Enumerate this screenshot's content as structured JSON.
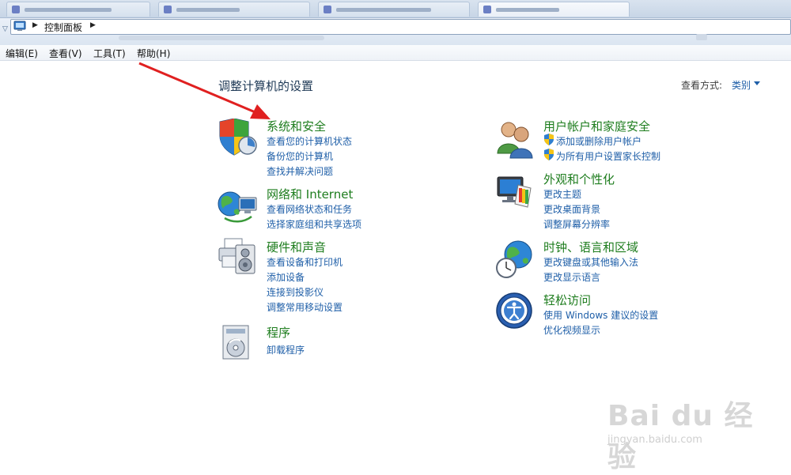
{
  "address": {
    "location": "控制面板"
  },
  "menu": [
    "编辑(E)",
    "查看(V)",
    "工具(T)",
    "帮助(H)"
  ],
  "page": {
    "title": "调整计算机的设置",
    "view_by_label": "查看方式:",
    "view_by_value": "类别"
  },
  "categories": [
    {
      "title": "系统和安全",
      "icon": "shield-system-icon",
      "links": [
        "查看您的计算机状态",
        "备份您的计算机",
        "查找并解决问题"
      ]
    },
    {
      "title": "网络和 Internet",
      "icon": "network-globe-icon",
      "links": [
        "查看网络状态和任务",
        "选择家庭组和共享选项"
      ]
    },
    {
      "title": "硬件和声音",
      "icon": "printer-speaker-icon",
      "links": [
        "查看设备和打印机",
        "添加设备",
        "连接到投影仪",
        "调整常用移动设置"
      ]
    },
    {
      "title": "程序",
      "icon": "programs-icon",
      "links": [
        "卸载程序"
      ]
    },
    {
      "title": "用户帐户和家庭安全",
      "icon": "users-icon",
      "links": [
        "添加或删除用户帐户",
        "为所有用户设置家长控制"
      ]
    },
    {
      "title": "外观和个性化",
      "icon": "monitor-palette-icon",
      "links": [
        "更改主题",
        "更改桌面背景",
        "调整屏幕分辨率"
      ]
    },
    {
      "title": "时钟、语言和区域",
      "icon": "clock-globe-icon",
      "links": [
        "更改键盘或其他输入法",
        "更改显示语言"
      ]
    },
    {
      "title": "轻松访问",
      "icon": "ease-of-access-icon",
      "links": [
        "使用 Windows 建议的设置",
        "优化视频显示"
      ]
    }
  ],
  "watermark": {
    "logo": "Bai du 经验",
    "url": "jingyan.baidu.com"
  },
  "colors": {
    "category_title": "#1e7d1e",
    "link": "#1f5fa8",
    "arrow": "#e02020"
  }
}
